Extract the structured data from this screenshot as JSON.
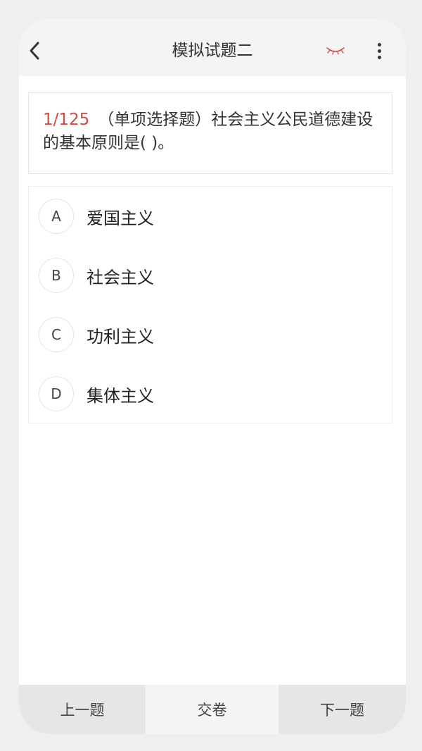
{
  "header": {
    "title": "模拟试题二",
    "back_icon": "chevron-left-icon",
    "eye_icon": "eye-closed-icon",
    "more_icon": "more-vertical-icon",
    "eye_color": "#d44a4a"
  },
  "question": {
    "number": "1/125",
    "text": "（单项选择题）社会主义公民道德建设的基本原则是( )。"
  },
  "options": [
    {
      "letter": "A",
      "text": "爱国主义"
    },
    {
      "letter": "B",
      "text": "社会主义"
    },
    {
      "letter": "C",
      "text": "功利主义"
    },
    {
      "letter": "D",
      "text": "集体主义"
    }
  ],
  "footer": {
    "prev_label": "上一题",
    "submit_label": "交卷",
    "next_label": "下一题"
  }
}
